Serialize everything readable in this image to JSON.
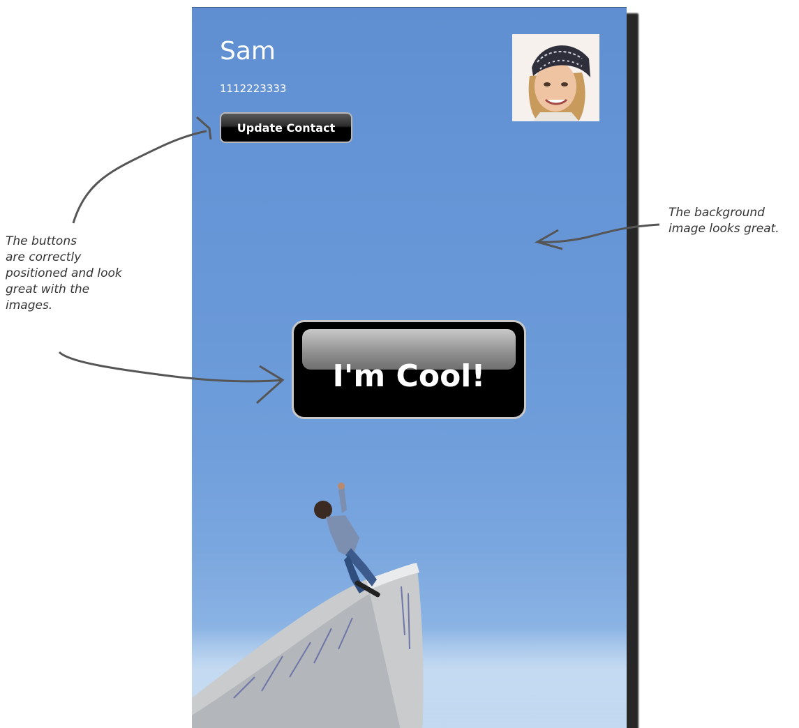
{
  "contact": {
    "name": "Sam",
    "phone": "1112223333",
    "photo_icon": "contact-photo"
  },
  "buttons": {
    "update_contact": "Update Contact",
    "cool": "I'm Cool!"
  },
  "annotations": {
    "left": "The buttons\nare correctly\npositioned and look\ngreat with the\nimages.",
    "right": "The background\nimage looks great."
  },
  "colors": {
    "background_sky": "#6a99d8",
    "button_black": "#000000",
    "annotation_ink": "#333333"
  }
}
